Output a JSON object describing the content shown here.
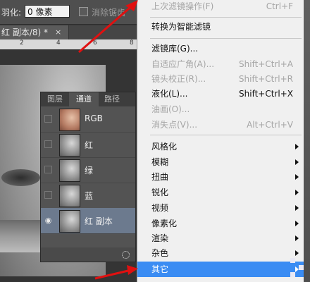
{
  "options_bar": {
    "feather_label": "羽化:",
    "feather_value": "0 像素",
    "antialias_label": "消除锯齿"
  },
  "document": {
    "tab_title": "红 副本/8) *",
    "close": "×",
    "ruler_marks": [
      "2",
      "4",
      "6",
      "8"
    ]
  },
  "channels_panel": {
    "tabs": [
      "图层",
      "通道",
      "路径"
    ],
    "active_tab": "通道",
    "channels": [
      {
        "name": "RGB",
        "visible": false,
        "selected": false
      },
      {
        "name": "红",
        "visible": false,
        "selected": false
      },
      {
        "name": "绿",
        "visible": false,
        "selected": false
      },
      {
        "name": "蓝",
        "visible": false,
        "selected": false
      },
      {
        "name": "红 副本",
        "visible": true,
        "selected": true
      }
    ]
  },
  "filter_menu": {
    "items": [
      {
        "label": "上次滤镜操作(F)",
        "shortcut": "Ctrl+F",
        "disabled": true
      },
      {
        "label": "转换为智能滤镜",
        "disabled": false
      },
      {
        "label": "滤镜库(G)...",
        "disabled": false
      },
      {
        "label": "自适应广角(A)...",
        "shortcut": "Shift+Ctrl+A",
        "disabled": true
      },
      {
        "label": "镜头校正(R)...",
        "shortcut": "Shift+Ctrl+R",
        "disabled": true
      },
      {
        "label": "液化(L)...",
        "shortcut": "Shift+Ctrl+X",
        "disabled": false
      },
      {
        "label": "油画(O)...",
        "disabled": true
      },
      {
        "label": "消失点(V)...",
        "shortcut": "Alt+Ctrl+V",
        "disabled": true
      },
      {
        "label": "风格化",
        "submenu": true
      },
      {
        "label": "模糊",
        "submenu": true
      },
      {
        "label": "扭曲",
        "submenu": true
      },
      {
        "label": "锐化",
        "submenu": true
      },
      {
        "label": "视频",
        "submenu": true
      },
      {
        "label": "像素化",
        "submenu": true
      },
      {
        "label": "渲染",
        "submenu": true
      },
      {
        "label": "杂色",
        "submenu": true
      },
      {
        "label": "其它",
        "submenu": true,
        "highlighted": true
      }
    ]
  },
  "colors": {
    "menu_highlight": "#3a8cf3",
    "arrow": "#e01010",
    "selected_channel": "#6c7a8e"
  }
}
